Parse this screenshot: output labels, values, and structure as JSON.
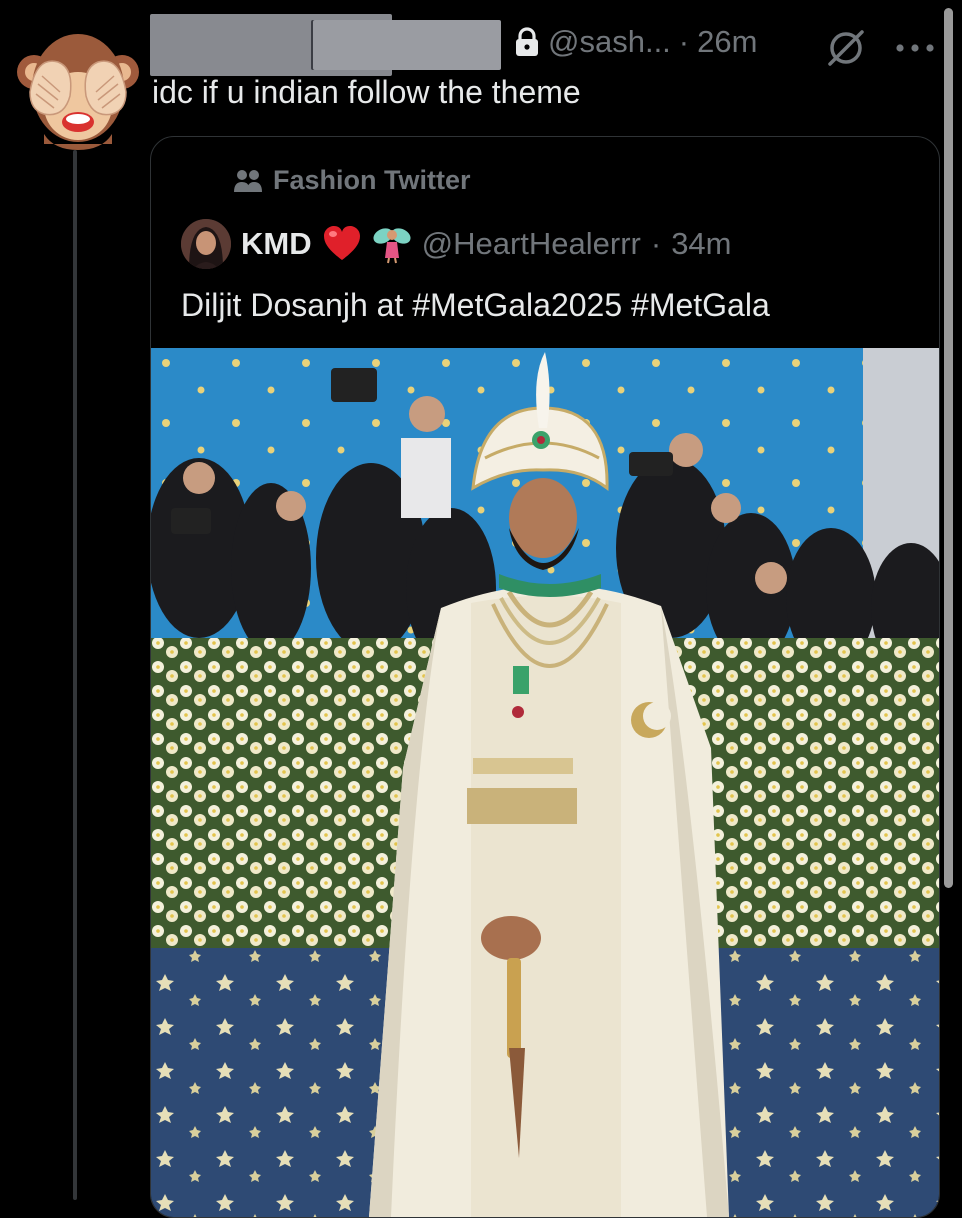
{
  "post": {
    "handle": "@sash...",
    "separator": "·",
    "time": "26m",
    "text": "idc if u indian follow the theme"
  },
  "quote": {
    "community_label": "Fashion Twitter",
    "author_name": "KMD",
    "author_emojis": [
      "red-heart",
      "fairy"
    ],
    "author_handle": "@HeartHealerrr",
    "separator": "·",
    "time": "34m",
    "text": "Diljit Dosanjh at #MetGala2025 #MetGala"
  },
  "icons": {
    "avatar": "see-no-evil-monkey-emoji",
    "lock": "lock-icon",
    "grok": "grok-icon",
    "more": "more-icon",
    "community": "community-icon"
  },
  "colors": {
    "background": "#000000",
    "text_primary": "#e7e9ea",
    "text_secondary": "#71767b",
    "border": "#2f3336"
  }
}
